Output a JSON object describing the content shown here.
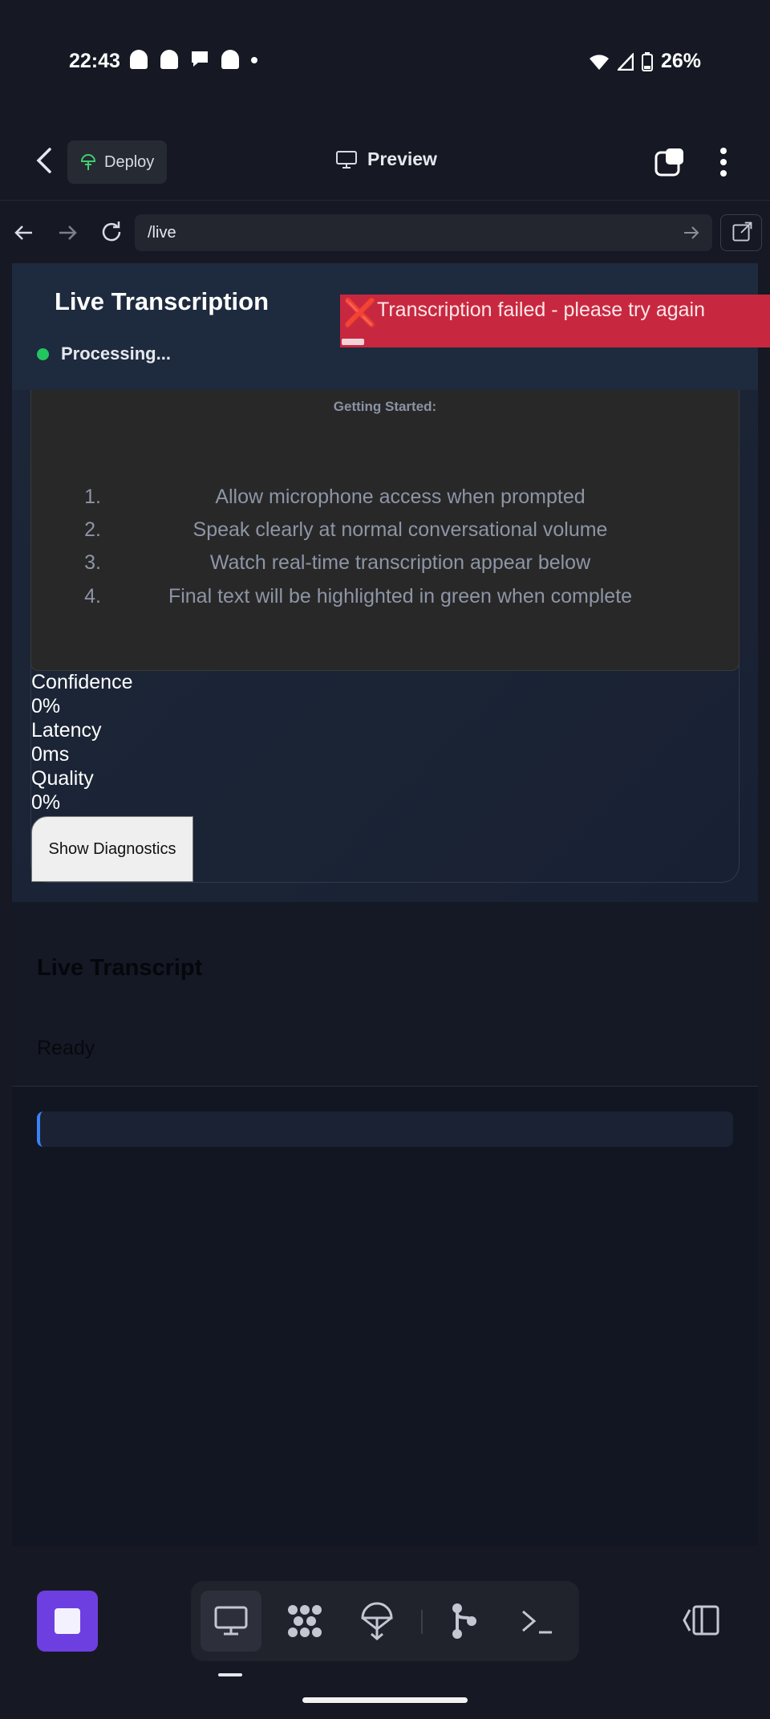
{
  "status_bar": {
    "time": "22:43",
    "notification_icons": [
      "snapchat-icon",
      "snapchat-icon",
      "chat-icon",
      "snapchat-icon",
      "dot-icon"
    ],
    "battery": "26%"
  },
  "app_header": {
    "deploy_label": "Deploy",
    "preview_label": "Preview"
  },
  "browser": {
    "url": "/live"
  },
  "page": {
    "title": "Live Transcription",
    "status": "Processing...",
    "toast": {
      "icon": "❌",
      "message": "Transcription failed - please try again"
    },
    "getting_started": {
      "heading": "Getting Started:",
      "steps": [
        {
          "num": "1.",
          "text": "Allow microphone access when prompted"
        },
        {
          "num": "2.",
          "text": "Speak clearly at normal conversational volume"
        },
        {
          "num": "3.",
          "text": "Watch real-time transcription appear below"
        },
        {
          "num": "4.",
          "text": "Final text will be highlighted in green when complete"
        }
      ]
    },
    "metrics": [
      {
        "label": "Confidence",
        "value": "0%"
      },
      {
        "label": "Latency",
        "value": "0ms"
      },
      {
        "label": "Quality",
        "value": "0%"
      }
    ],
    "diagnostics_button": "Show Diagnostics",
    "transcript": {
      "title": "Live Transcript",
      "status": "Ready"
    }
  },
  "colors": {
    "accent_purple": "#6d3fe0",
    "error_red": "#c8283f",
    "status_green": "#22c55e",
    "transcript_accent": "#3b82f6"
  }
}
